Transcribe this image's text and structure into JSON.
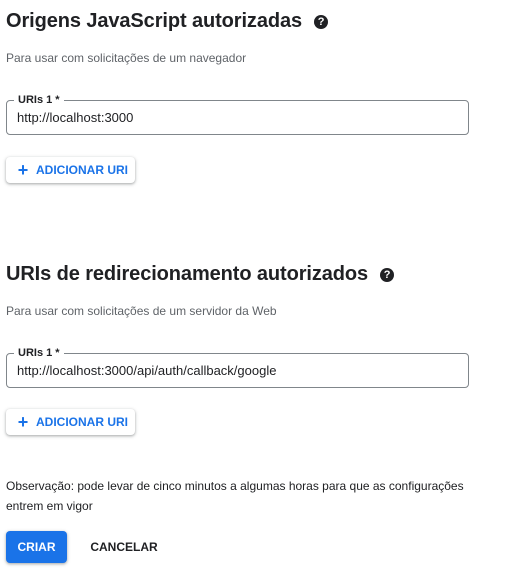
{
  "origins": {
    "title": "Origens JavaScript autorizadas",
    "help_icon": "?",
    "description": "Para usar com solicitações de um navegador",
    "uris": [
      {
        "label": "URIs 1 *",
        "value": "http://localhost:3000"
      }
    ],
    "add_button": {
      "icon": "+",
      "label": "ADICIONAR URI"
    }
  },
  "redirects": {
    "title": "URIs de redirecionamento autorizados",
    "help_icon": "?",
    "description": "Para usar com solicitações de um servidor da Web",
    "uris": [
      {
        "label": "URIs 1 *",
        "value": "http://localhost:3000/api/auth/callback/google"
      }
    ],
    "add_button": {
      "icon": "+",
      "label": "ADICIONAR URI"
    }
  },
  "note": "Observação: pode levar de cinco minutos a algumas horas para que as configurações entrem em vigor",
  "actions": {
    "create_label": "CRIAR",
    "cancel_label": "CANCELAR"
  },
  "colors": {
    "accent": "#1a73e8",
    "text": "#202124",
    "secondary_text": "#5f6368",
    "border": "#80868b"
  }
}
